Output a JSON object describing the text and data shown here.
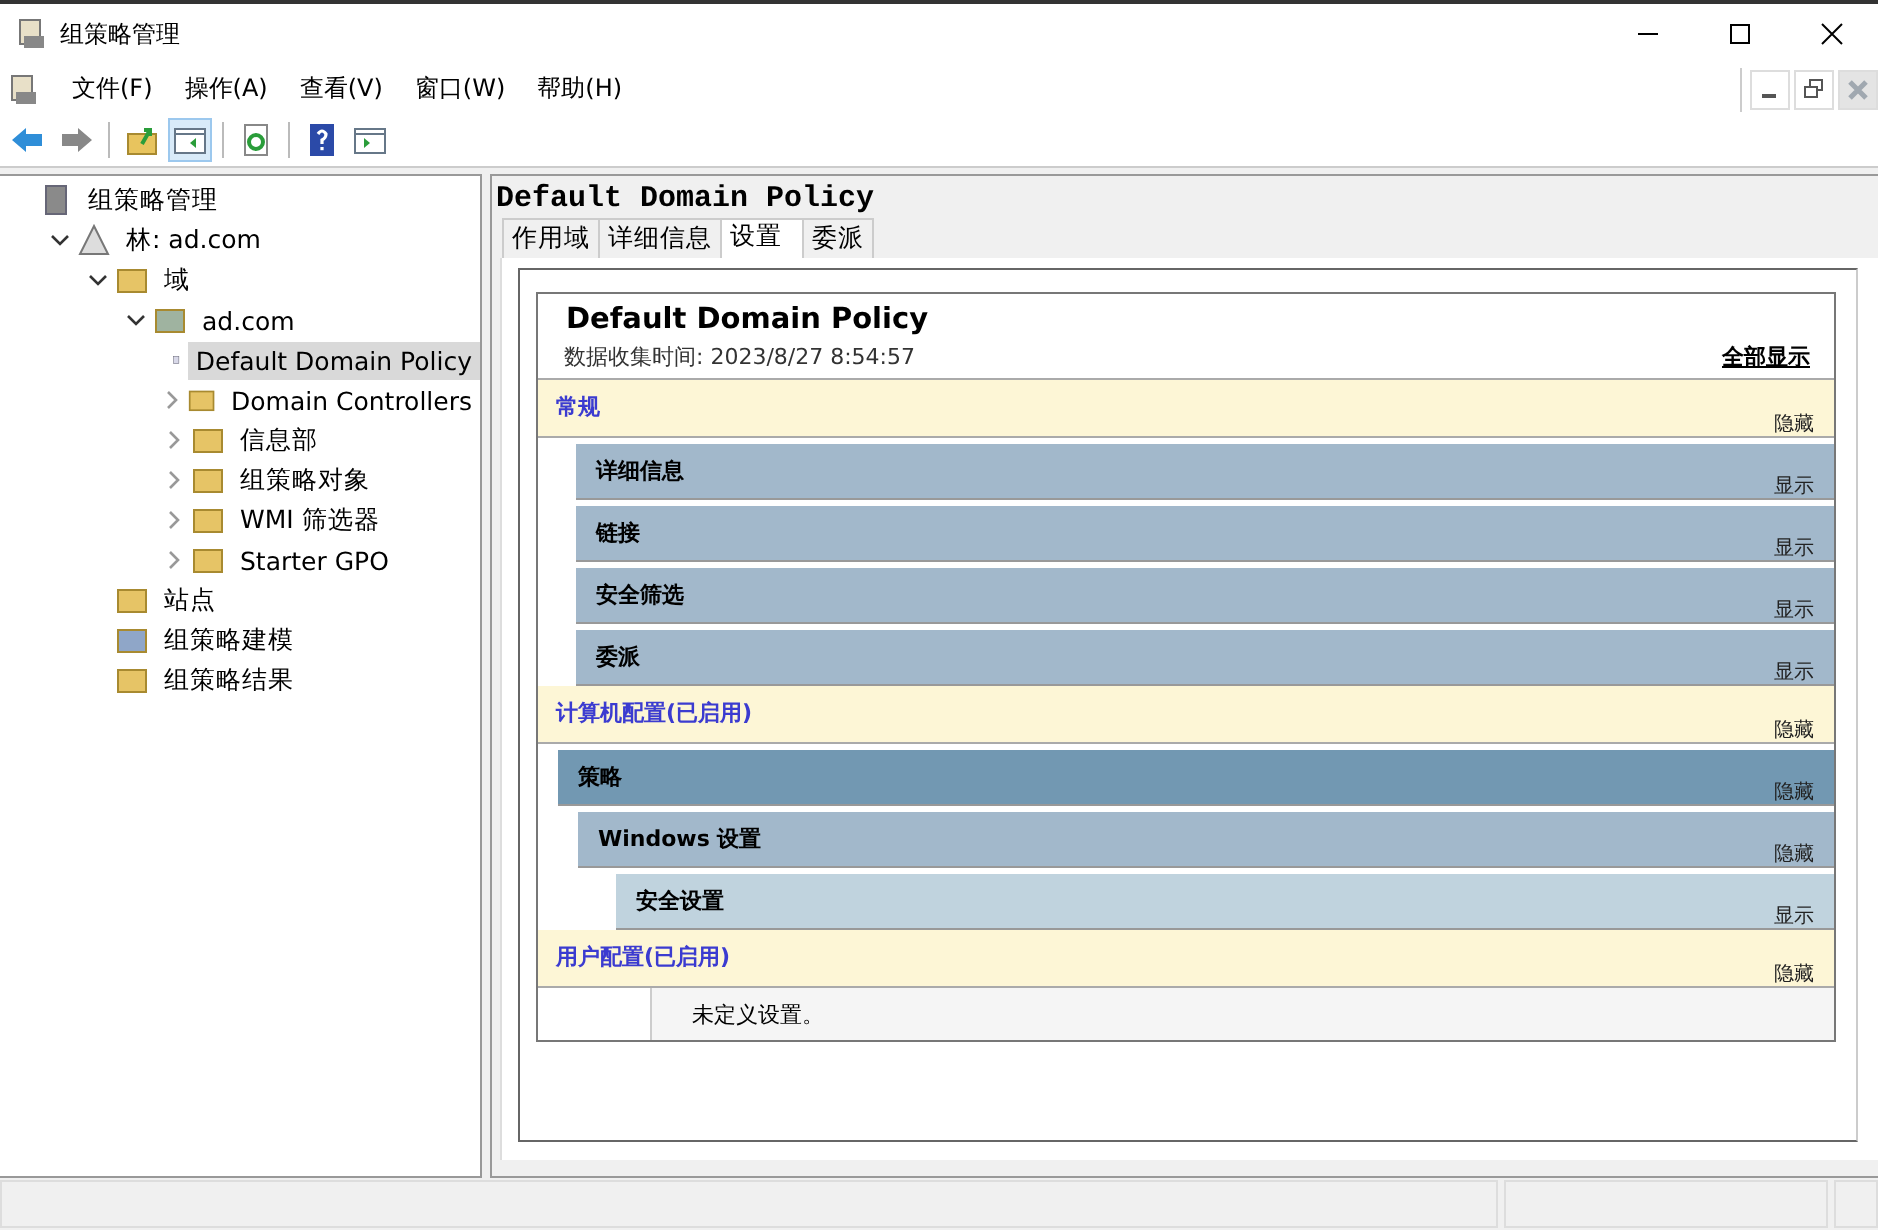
{
  "window": {
    "title": "组策略管理"
  },
  "menu": [
    "文件(F)",
    "操作(A)",
    "查看(V)",
    "窗口(W)",
    "帮助(H)"
  ],
  "toolbar": [
    {
      "kind": "back",
      "disabled": false,
      "pressed": false
    },
    {
      "kind": "forward",
      "disabled": true,
      "pressed": false
    },
    {
      "kind": "sep"
    },
    {
      "kind": "up",
      "disabled": false,
      "pressed": false
    },
    {
      "kind": "tree",
      "disabled": false,
      "pressed": true
    },
    {
      "kind": "sep"
    },
    {
      "kind": "refresh",
      "disabled": false,
      "pressed": false
    },
    {
      "kind": "sep"
    },
    {
      "kind": "help",
      "disabled": false,
      "pressed": false
    },
    {
      "kind": "pane",
      "disabled": false,
      "pressed": false
    }
  ],
  "tree": [
    {
      "label": "组策略管理",
      "kind": "root",
      "selected": false,
      "children": [
        {
          "label": "林: ad.com",
          "kind": "forest",
          "selected": false,
          "expanded": true,
          "children": [
            {
              "label": "域",
              "kind": "domains",
              "selected": false,
              "expanded": true,
              "children": [
                {
                  "label": "ad.com",
                  "kind": "domain",
                  "selected": false,
                  "expanded": true,
                  "children": [
                    {
                      "label": "Default Domain Policy",
                      "kind": "gpo",
                      "selected": true
                    },
                    {
                      "label": "Domain Controllers",
                      "kind": "ou",
                      "selected": false,
                      "expanded": false
                    },
                    {
                      "label": "信息部",
                      "kind": "ou",
                      "selected": false,
                      "expanded": false
                    },
                    {
                      "label": "组策略对象",
                      "kind": "gpofolder",
                      "selected": false,
                      "expanded": false
                    },
                    {
                      "label": "WMI 筛选器",
                      "kind": "wmi",
                      "selected": false,
                      "expanded": false
                    },
                    {
                      "label": "Starter GPO",
                      "kind": "starter",
                      "selected": false,
                      "expanded": false
                    }
                  ]
                }
              ]
            },
            {
              "label": "站点",
              "kind": "sites",
              "selected": false
            },
            {
              "label": "组策略建模",
              "kind": "modeling",
              "selected": false
            },
            {
              "label": "组策略结果",
              "kind": "results",
              "selected": false
            }
          ]
        }
      ]
    }
  ],
  "detail": {
    "title": "Default Domain Policy",
    "tabs": [
      {
        "label": "作用域",
        "selected": false
      },
      {
        "label": "详细信息",
        "selected": false
      },
      {
        "label": "设置",
        "selected": true
      },
      {
        "label": "委派",
        "selected": false
      }
    ],
    "report": {
      "title": "Default Domain Policy",
      "collected": "数据收集时间: 2023/8/27 8:54:57",
      "show_all": "全部显示",
      "sections": [
        {
          "kind": "category",
          "title": "常规",
          "toggle": "隐藏",
          "children": [
            {
              "kind": "heading",
              "title": "详细信息",
              "toggle": "显示",
              "expanded": false
            },
            {
              "kind": "heading",
              "title": "链接",
              "toggle": "显示",
              "expanded": false
            },
            {
              "kind": "heading",
              "title": "安全筛选",
              "toggle": "显示",
              "expanded": false
            },
            {
              "kind": "heading",
              "title": "委派",
              "toggle": "显示",
              "expanded": false
            }
          ]
        },
        {
          "kind": "category",
          "title": "计算机配置(已启用)",
          "toggle": "隐藏",
          "children": [
            {
              "kind": "heading",
              "title": "策略",
              "toggle": "隐藏",
              "expanded": true,
              "children": [
                {
                  "kind": "heading",
                  "title": "Windows 设置",
                  "toggle": "隐藏",
                  "expanded": true,
                  "children": [
                    {
                      "kind": "heading",
                      "title": "安全设置",
                      "toggle": "显示",
                      "expanded": false
                    }
                  ]
                }
              ]
            }
          ]
        },
        {
          "kind": "category",
          "title": "用户配置(已启用)",
          "toggle": "隐藏",
          "children": [
            {
              "kind": "note",
              "title": "未定义设置。"
            }
          ]
        }
      ]
    }
  }
}
